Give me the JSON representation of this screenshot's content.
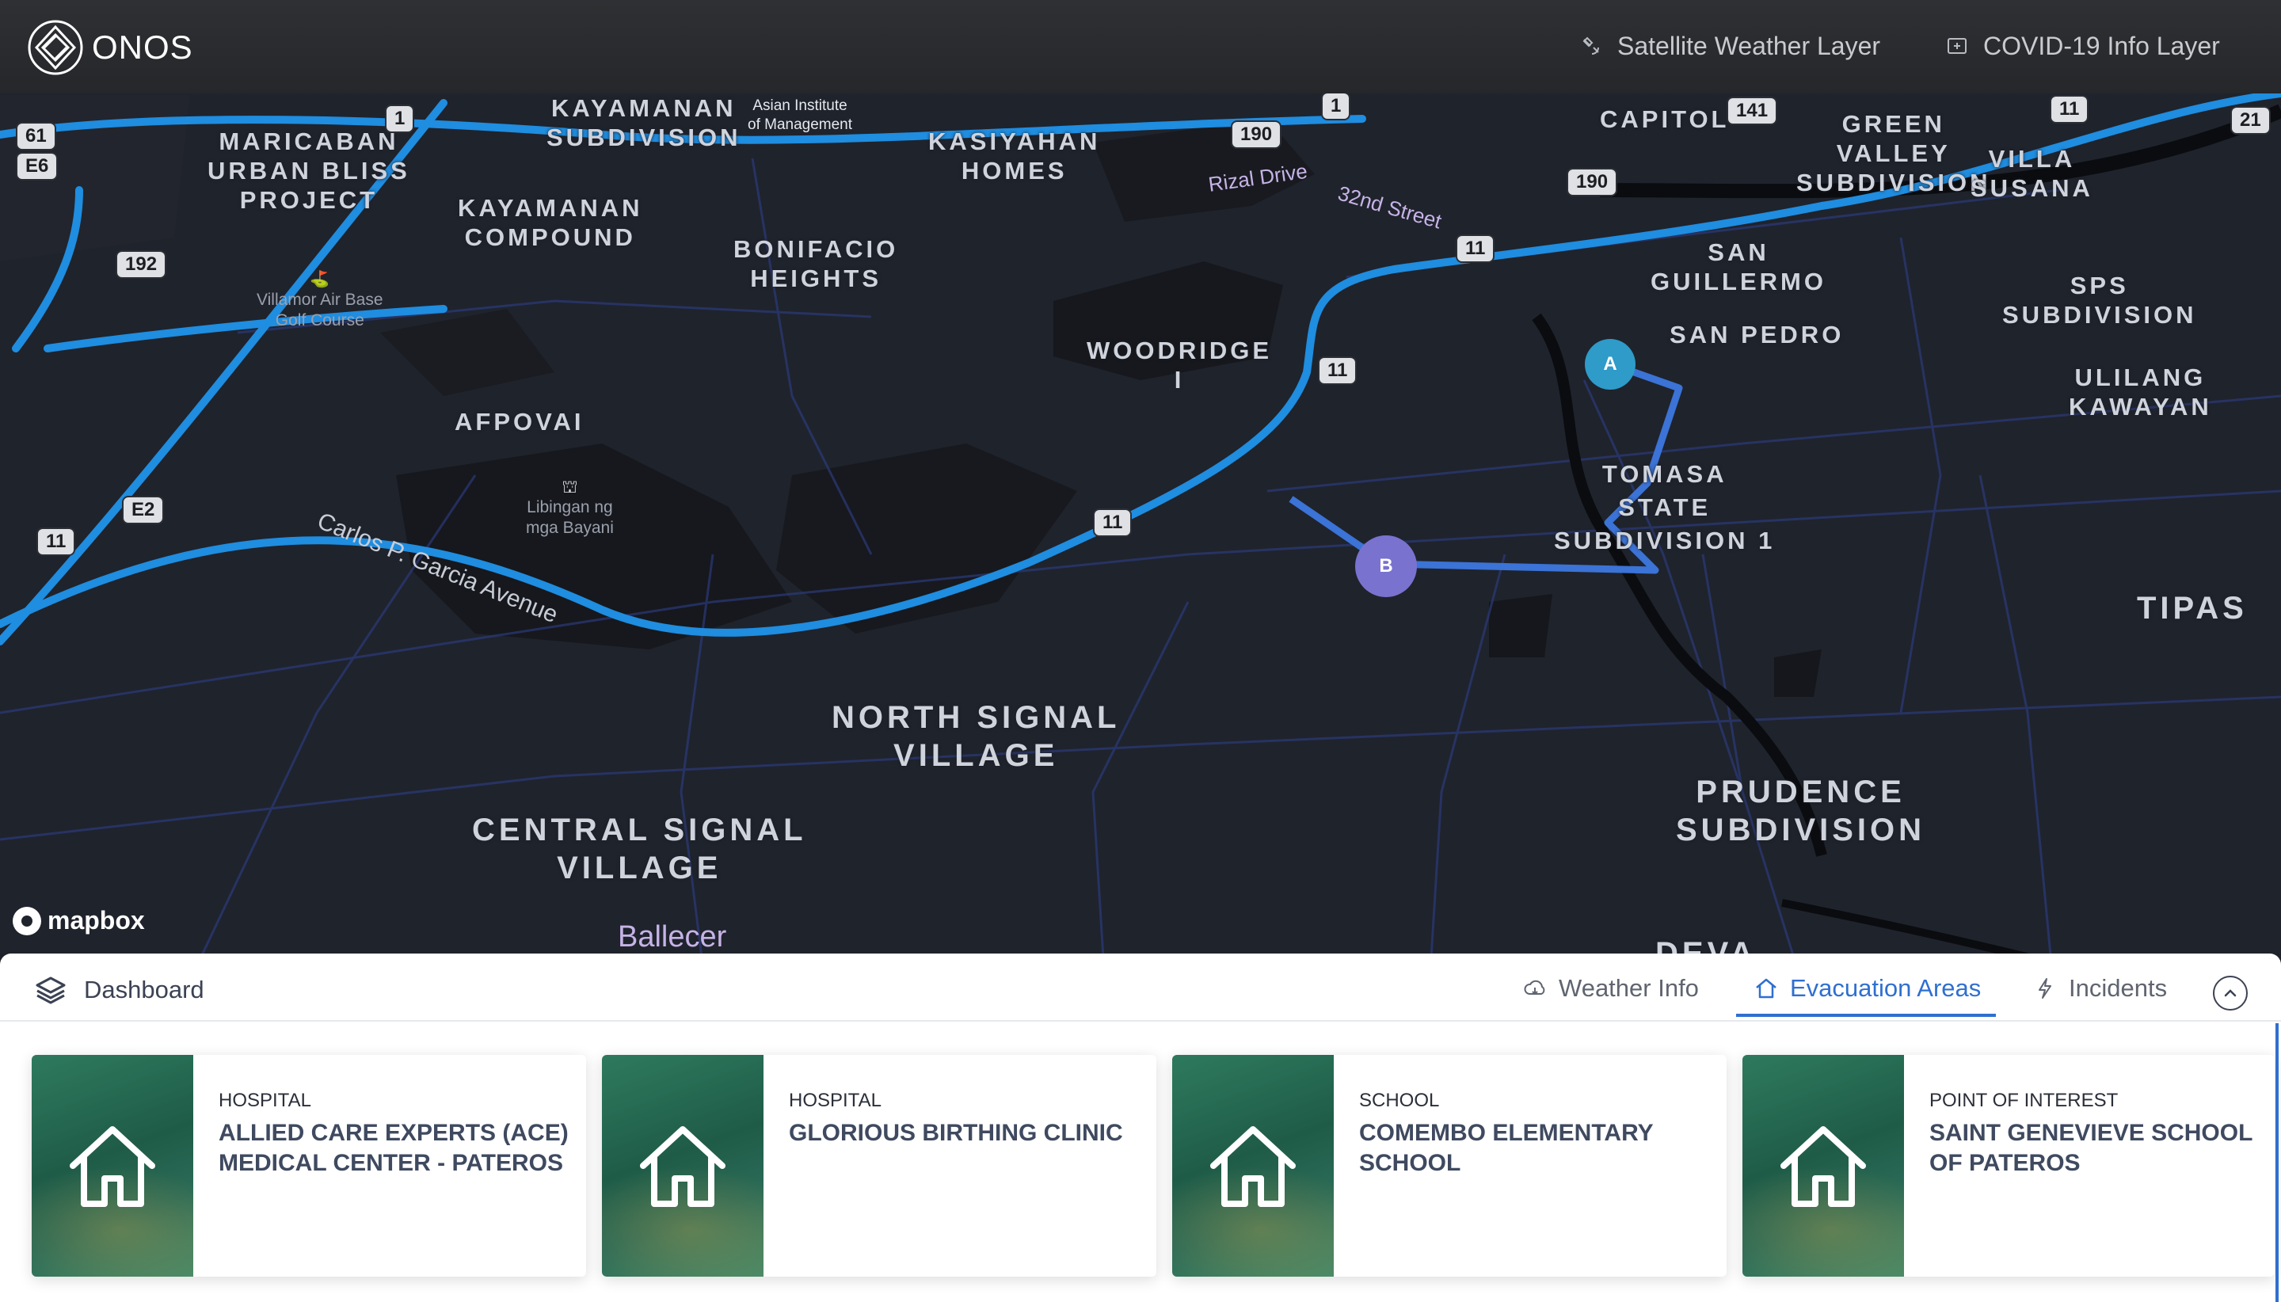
{
  "header": {
    "brand": "ONOS",
    "buttons": [
      {
        "label": "Satellite Weather Layer",
        "icon": "satellite-icon"
      },
      {
        "label": "COVID-19 Info Layer",
        "icon": "info-layer-icon"
      }
    ]
  },
  "map": {
    "places": {
      "maricaban": "MARICABAN\nURBAN BLISS\nPROJECT",
      "kayamanan_subd": "KAYAMANAN\nSUBDIVISION",
      "kayamanan_comp": "KAYAMANAN\nCOMPOUND",
      "kasiyahan": "KASIYAHAN\nHOMES",
      "bonifacio": "BONIFACIO\nHEIGHTS",
      "capitol": "CAPITOL",
      "green_valley": "GREEN\nVALLEY\nSUBDIVISION",
      "villa_susana": "VILLA\nSUSANA",
      "san_guillermo": "SAN\nGUILLERMO",
      "sps": "SPS\nSUBDIVISION",
      "san_pedro": "SAN PEDRO",
      "woodridge": "WOODRIDGE\nI",
      "ulilang": "ULILANG\nKAWAYAN",
      "afpovai": "AFPOVAI",
      "tomasa": "TOMASA\nSTATE\nSUBDIVISION 1",
      "tipas": "TIPAS",
      "north_signal": "NORTH SIGNAL\nVILLAGE",
      "prudence": "PRUDENCE\nSUBDIVISION",
      "central_signal": "CENTRAL SIGNAL\nVILLAGE",
      "deva": "DEVA"
    },
    "pois": {
      "asian_institute": "Asian Institute\nof Management",
      "villamor": "Villamor Air Base\nGolf Course",
      "libingan": "Libingan ng\nmga Bayani"
    },
    "streets": {
      "rizal": "Rizal Drive",
      "32nd": "32nd Street",
      "carlos": "Carlos P. Garcia Avenue",
      "ballecer": "Ballecer"
    },
    "shields": [
      "61",
      "E6",
      "192",
      "E2",
      "11",
      "1",
      "190",
      "190",
      "1",
      "141",
      "11",
      "21",
      "11",
      "11",
      "11"
    ],
    "markers": {
      "a": "A",
      "b": "B"
    },
    "attribution": "mapbox"
  },
  "dashboard": {
    "title": "Dashboard",
    "tabs": [
      {
        "label": "Weather Info",
        "icon": "cloud-icon",
        "active": false
      },
      {
        "label": "Evacuation Areas",
        "icon": "home-icon",
        "active": true
      },
      {
        "label": "Incidents",
        "icon": "bolt-icon",
        "active": false
      }
    ],
    "cards": [
      {
        "kind": "HOSPITAL",
        "name": "ALLIED CARE EXPERTS (ACE) MEDICAL CENTER - PATEROS"
      },
      {
        "kind": "HOSPITAL",
        "name": "GLORIOUS BIRTHING CLINIC"
      },
      {
        "kind": "SCHOOL",
        "name": "COMEMBO ELEMENTARY SCHOOL"
      },
      {
        "kind": "POINT OF INTEREST",
        "name": "SAINT GENEVIEVE SCHOOL OF PATEROS"
      }
    ]
  },
  "colors": {
    "accent": "#2f6fd0",
    "route": "#3b73d6",
    "highway": "#1f8de0",
    "map_bg": "#1f232c"
  }
}
